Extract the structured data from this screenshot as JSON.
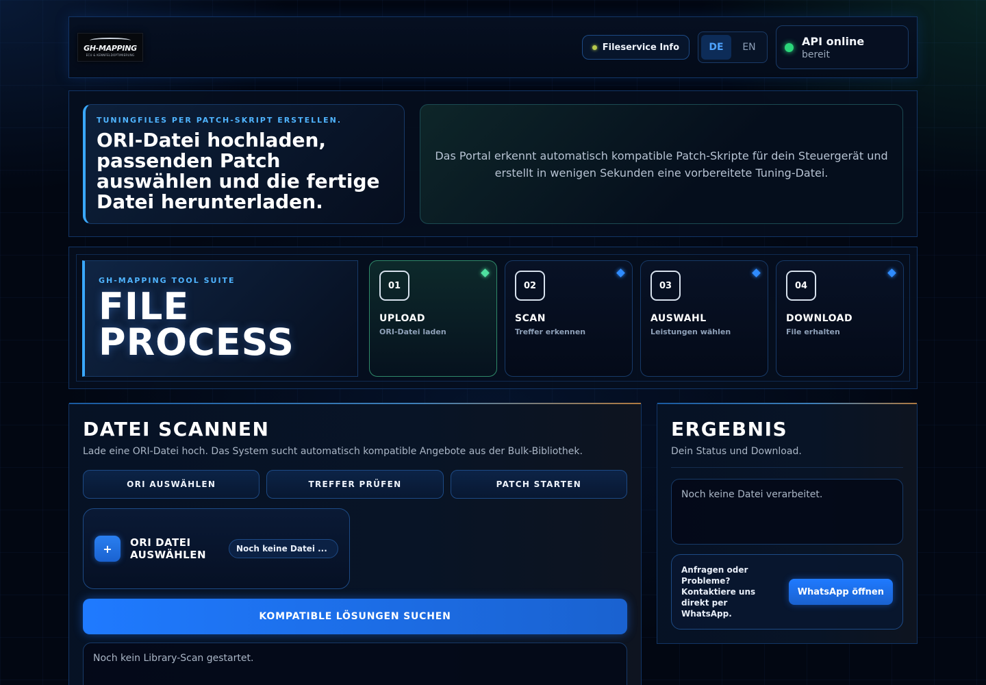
{
  "header": {
    "logo": {
      "main": "GH-MAPPING",
      "sub": "ECU & KENNFELDOPTIMIERUNG"
    },
    "fileservice_label": "Fileservice Info",
    "languages": [
      {
        "code": "DE",
        "active": true
      },
      {
        "code": "EN",
        "active": false
      }
    ],
    "api": {
      "title": "API online",
      "status": "bereit"
    }
  },
  "hero": {
    "eyebrow": "TUNINGFILES PER PATCH-SKRIPT ERSTELLEN.",
    "title": "ORI-Datei hochladen, passenden Patch auswählen und die fertige Datei herunterladen.",
    "description": "Das Portal erkennt automatisch kompatible Patch-Skripte für dein Steuergerät und erstellt in wenigen Sekunden eine vorbereitete Tuning-Datei."
  },
  "process": {
    "eyebrow": "GH-MAPPING TOOL SUITE",
    "title_line1": "FILE",
    "title_line2": "PROCESS",
    "steps": [
      {
        "num": "01",
        "name": "UPLOAD",
        "desc": "ORI-Datei laden",
        "active": true
      },
      {
        "num": "02",
        "name": "SCAN",
        "desc": "Treffer erkennen",
        "active": false
      },
      {
        "num": "03",
        "name": "AUSWAHL",
        "desc": "Leistungen wählen",
        "active": false
      },
      {
        "num": "04",
        "name": "DOWNLOAD",
        "desc": "File erhalten",
        "active": false
      }
    ]
  },
  "scan": {
    "title": "DATEI SCANNEN",
    "subtitle": "Lade eine ORI-Datei hoch. Das System sucht automatisch kompatible Angebote aus der Bulk-Bibliothek.",
    "buttons": [
      "ORI AUSWÄHLEN",
      "TREFFER PRÜFEN",
      "PATCH STARTEN"
    ],
    "upload_label": "ORI DATEI AUSWÄHLEN",
    "file_chip": "Noch keine Datei ...",
    "search_label": "KOMPATIBLE LÖSUNGEN SUCHEN",
    "status": "Noch kein Library-Scan gestartet."
  },
  "result": {
    "title": "ERGEBNIS",
    "subtitle": "Dein Status und Download.",
    "status": "Noch keine Datei verarbeitet.",
    "contact_text": "Anfragen oder Probleme? Kontaktiere uns direkt per WhatsApp.",
    "whatsapp_label": "WhatsApp öffnen"
  },
  "colors": {
    "accent": "#1f7aff",
    "online": "#2bd67a",
    "step_active": "#4fe0a0",
    "eyebrow": "#4fb4ff"
  }
}
